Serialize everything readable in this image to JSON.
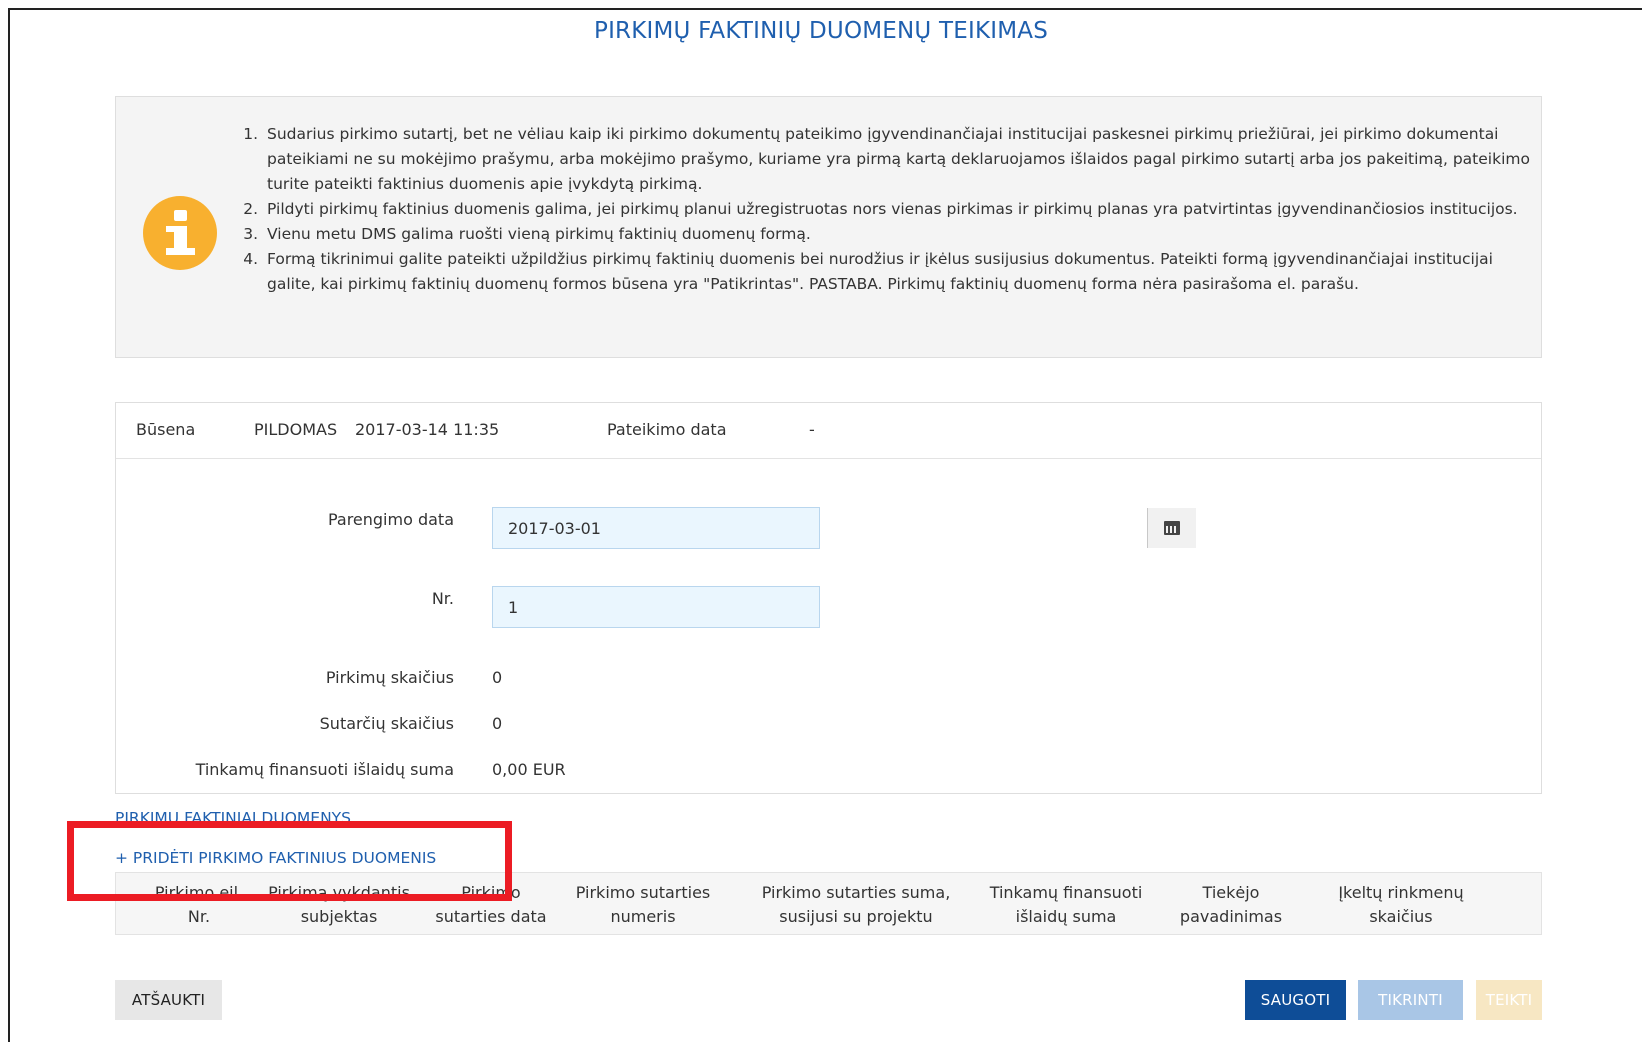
{
  "page": {
    "title": "PIRKIMŲ FAKTINIŲ DUOMENŲ TEIKIMAS"
  },
  "info": {
    "icon": "info-circle-icon",
    "items": [
      "Sudarius pirkimo sutartį, bet ne vėliau kaip iki pirkimo dokumentų pateikimo įgyvendinančiajai institucijai paskesnei pirkimų priežiūrai, jei pirkimo dokumentai pateikiami ne su mokėjimo prašymu, arba mokėjimo prašymo, kuriame yra pirmą kartą deklaruojamos išlaidos pagal pirkimo sutartį arba jos pakeitimą, pateikimo turite pateikti faktinius duomenis apie įvykdytą pirkimą.",
      "Pildyti pirkimų faktinius duomenis galima, jei pirkimų planui užregistruotas nors vienas pirkimas ir pirkimų planas yra patvirtintas įgyvendinančiosios institucijos.",
      "Vienu metu DMS galima ruošti vieną pirkimų faktinių duomenų formą.",
      "Formą tikrinimui galite pateikti užpildžius pirkimų faktinių duomenis bei nurodžius ir įkėlus susijusius dokumentus. Pateikti formą įgyvendinančiajai institucijai galite, kai pirkimų faktinių duomenų formos būsena yra \"Patikrintas\". PASTABA. Pirkimų faktinių duomenų forma nėra pasirašoma el. parašu."
    ]
  },
  "status": {
    "label": "Būsena",
    "value": "PILDOMAS",
    "datetime": "2017-03-14 11:35",
    "submit_label": "Pateikimo data",
    "submit_value": "-"
  },
  "form": {
    "prep_date_label": "Parengimo data",
    "prep_date_value": "2017-03-01",
    "nr_label": "Nr.",
    "nr_value": "1",
    "purchases_label": "Pirkimų skaičius",
    "purchases_value": "0",
    "contracts_label": "Sutarčių skaičius",
    "contracts_value": "0",
    "sum_label": "Tinkamų finansuoti išlaidų suma",
    "sum_value": "0,00 EUR",
    "calendar_icon": "calendar-icon"
  },
  "section": {
    "title": "PIRKIMŲ FAKTINIAI DUOMENYS",
    "add_link": "+ PRIDĖTI PIRKIMO FAKTINIUS DUOMENIS"
  },
  "table": {
    "columns": [
      "Pirkimo eil.\nNr.",
      "Pirkimą vykdantis\nsubjektas",
      "Pirkimo\nsutarties data",
      "Pirkimo sutarties\nnumeris",
      "Pirkimo sutarties suma,\nsusijusi su projektu",
      "Tinkamų finansuoti\nišlaidų suma",
      "Tiekėjo\npavadinimas",
      "Įkeltų rinkmenų\nskaičius"
    ]
  },
  "buttons": {
    "cancel": "ATŠAUKTI",
    "save": "SAUGOTI",
    "check": "TIKRINTI",
    "submit": "TEIKTI"
  },
  "colors": {
    "accent": "#1f5fae",
    "primary_button": "#0e4d97",
    "info_icon": "#f8b02f",
    "highlight": "#ec1c24"
  }
}
